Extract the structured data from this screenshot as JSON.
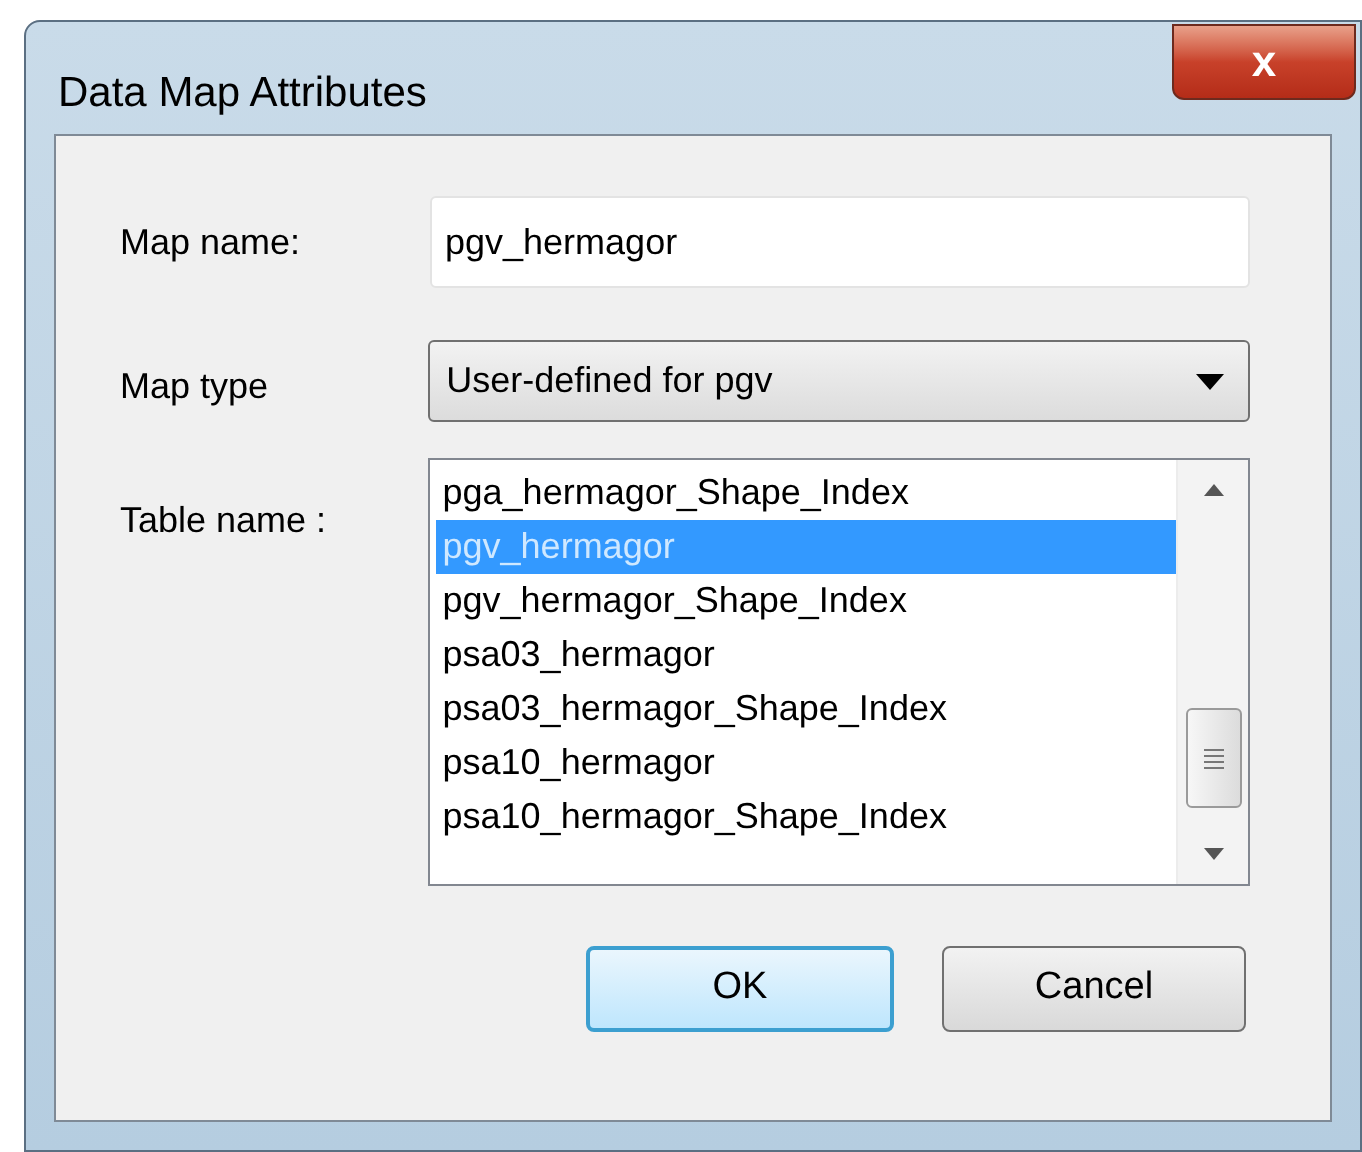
{
  "window": {
    "title": "Data Map Attributes",
    "close": "x"
  },
  "fields": [
    {
      "kind": "text",
      "label": "Map name:",
      "value": "pgv_hermagor"
    },
    {
      "kind": "dropdown",
      "label": "Map type",
      "value": "User-defined for pgv"
    },
    {
      "kind": "list",
      "label": "Table name :",
      "items": [
        {
          "label": "pga_hermagor_Shape_Index",
          "selected": false
        },
        {
          "label": "pgv_hermagor",
          "selected": true
        },
        {
          "label": "pgv_hermagor_Shape_Index",
          "selected": false
        },
        {
          "label": "psa03_hermagor",
          "selected": false
        },
        {
          "label": "psa03_hermagor_Shape_Index",
          "selected": false
        },
        {
          "label": "psa10_hermagor",
          "selected": false
        },
        {
          "label": "psa10_hermagor_Shape_Index",
          "selected": false
        }
      ]
    }
  ],
  "buttons": [
    {
      "label": "OK",
      "default": true
    },
    {
      "label": "Cancel",
      "default": false
    }
  ]
}
